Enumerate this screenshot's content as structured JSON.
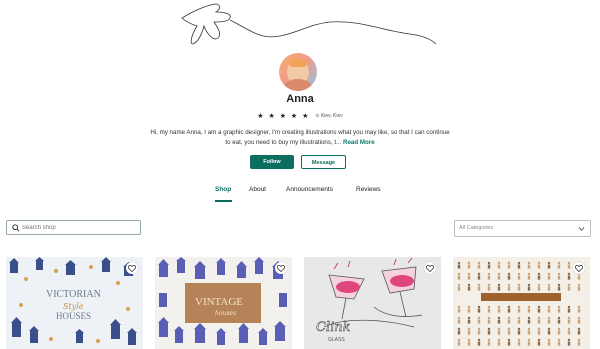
{
  "profile": {
    "name": "Anna",
    "stars": "★ ★ ★ ★ ★",
    "location": "⊙ Kiev, Kiev",
    "bio_text": "Hi, my name Anna, I am a graphic designer, I'm creating illustrations what you may like, so that I can continue to eat, you need to buy my illustrations, t...",
    "read_more": "Read More"
  },
  "actions": {
    "follow": "Follow",
    "message": "Message"
  },
  "tabs": [
    {
      "label": "Shop",
      "active": true
    },
    {
      "label": "About",
      "active": false
    },
    {
      "label": "Announcements",
      "active": false
    },
    {
      "label": "Reviews",
      "active": false
    }
  ],
  "search": {
    "placeholder": "Search shop"
  },
  "filter": {
    "selected": "All Categories"
  },
  "products": [
    {
      "title_line1": "VICTORIAN",
      "title_line2": "Style",
      "title_line3": "HOUSES"
    },
    {
      "title_line1": "VINTAGE",
      "title_line2": "houses"
    },
    {
      "title_line1": "Clink",
      "title_line2": "GLASS"
    },
    {
      "title": ""
    }
  ],
  "colors": {
    "accent": "#0b6e5f",
    "read_more": "#0b7a6c"
  },
  "icons": {
    "search": "search-icon",
    "favorite": "heart-icon",
    "dropdown": "chevron-down-icon"
  }
}
